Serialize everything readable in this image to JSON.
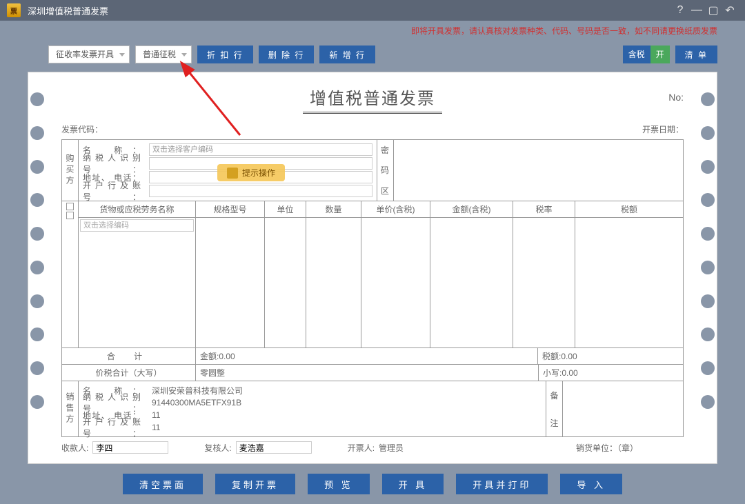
{
  "titlebar": {
    "title": "深圳增值税普通发票"
  },
  "warning": "即将开具发票，请认真核对发票种类、代码、号码是否一致，如不同请更换纸质发票",
  "toolbar": {
    "dropdown1": "征收率发票开具",
    "dropdown2": "普通征税",
    "discount": "折 扣 行",
    "delete": "删 除 行",
    "add": "新 增 行",
    "tax_label": "含税",
    "tax_on": "开",
    "list": "清  单"
  },
  "invoice": {
    "title": "增值税普通发票",
    "no_label": "No:",
    "code_label": "发票代码：",
    "date_label": "开票日期：",
    "buyer_label": "购买方",
    "buyer": {
      "name_label": "名        称",
      "name_placeholder": "双击选择客户编码",
      "taxid_label": "纳税人识别号",
      "addr_label": "地址、 电话",
      "bank_label": "开户行及账号"
    },
    "pwd_chars": [
      "密",
      "码",
      "区"
    ],
    "columns": {
      "name": "货物或应税劳务名称",
      "spec": "规格型号",
      "unit": "单位",
      "qty": "数量",
      "price": "单价(含税)",
      "amount": "金额(含税)",
      "rate": "税率",
      "tax": "税额"
    },
    "item_placeholder": "双击选择编码",
    "totals": {
      "label": "合    计",
      "amount": "金额:0.00",
      "tax": "税额:0.00"
    },
    "pricetax": {
      "label": "价税合计（大写）",
      "cn": "零圆整",
      "small": "小写:0.00"
    },
    "seller_label": "销售方",
    "seller": {
      "name_label": "名        称",
      "name": "深圳安荣普科技有限公司",
      "taxid_label": "纳税人识别号",
      "taxid": "91440300MA5ETFX91B",
      "addr_label": "地址、 电话",
      "addr": "11",
      "bank_label": "开户行及账号",
      "bank": "11"
    },
    "remark_chars": [
      "备",
      "注"
    ],
    "footer": {
      "payee_label": "收款人:",
      "payee": "李四",
      "reviewer_label": "复核人:",
      "reviewer": "麦浩嘉",
      "issuer_label": "开票人:",
      "issuer": "管理员",
      "seller_unit": "销货单位：（章）"
    }
  },
  "hint": "提示操作",
  "bottom": {
    "clear": "清空票面",
    "copy": "复制开票",
    "preview": "预  览",
    "issue": "开  具",
    "issue_print": "开具并打印",
    "import": "导  入"
  }
}
